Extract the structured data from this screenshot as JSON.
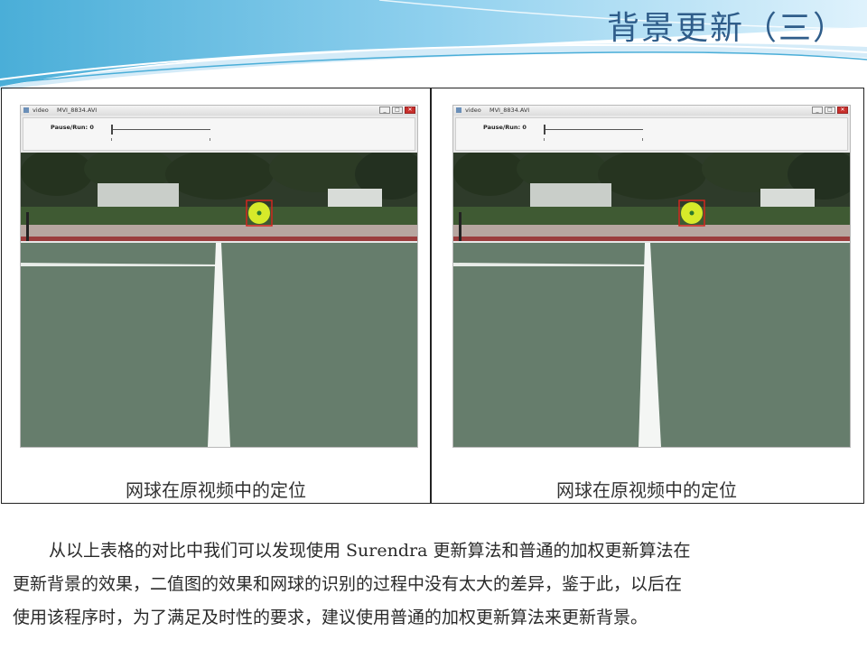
{
  "slide": {
    "title": "背景更新（三）"
  },
  "panels": [
    {
      "window_title": "video",
      "window_file": "MVI_8834.AVI",
      "window_buttons": [
        "_",
        "□",
        "✕"
      ],
      "trackbar_label": "Pause/Run: 0",
      "trackbar_value": 0,
      "caption": "网球在原视频中的定位"
    },
    {
      "window_title": "video",
      "window_file": "MVI_8834.AVI",
      "window_buttons": [
        "_",
        "□",
        "✕"
      ],
      "trackbar_label": "Pause/Run: 0",
      "trackbar_value": 0,
      "caption": "网球在原视频中的定位"
    }
  ],
  "body": {
    "lines": [
      "从以上表格的对比中我们可以发现使用 Surendra 更新算法和普通的加权更新算法在",
      "更新背景的效果，二值图的效果和网球的识别的过程中没有太大的差异，鉴于此，以后在",
      "使用该程序时，为了满足及时性的要求，建议使用普通的加权更新算法来更新背景。"
    ]
  },
  "colors": {
    "title": "#2f5d8a",
    "header_light": "#dff0fb",
    "header_mid": "#8ccbe8",
    "court": "#5f7566",
    "ball": "#d7ea2a",
    "detect_box": "#d0261f"
  }
}
